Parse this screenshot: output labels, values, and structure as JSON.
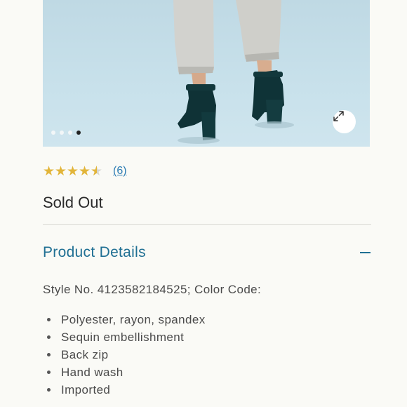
{
  "gallery": {
    "slide_count": 4,
    "active_slide": 4,
    "expand_icon": "expand-arrows-icon"
  },
  "rating": {
    "value": 4.5,
    "max": 5,
    "count_label": "(6)",
    "color": "#e2b53a"
  },
  "availability": "Sold Out",
  "details": {
    "title": "Product Details",
    "toggle_icon": "minus-icon",
    "style_line": "Style No. 4123582184525; Color Code:",
    "features": [
      "Polyester, rayon, spandex",
      "Sequin embellishment",
      "Back zip",
      "Hand wash",
      "Imported"
    ]
  },
  "colors": {
    "accent": "#1f6f93",
    "link": "#2a7bb3",
    "background": "#fafaf6"
  }
}
